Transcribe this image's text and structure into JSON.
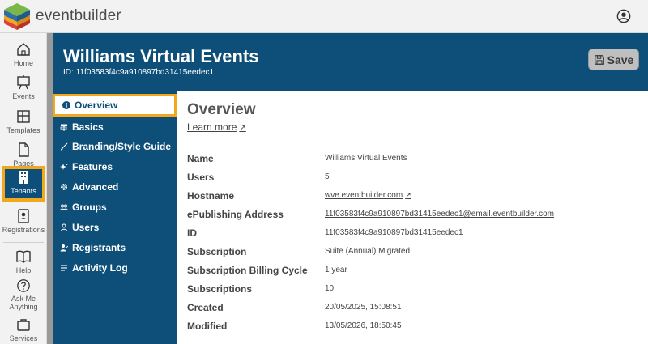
{
  "app": {
    "brand": "eventbuilder"
  },
  "colors": {
    "primary": "#0d4f78",
    "highlight": "#f2a81d"
  },
  "rail": {
    "items": [
      {
        "label": "Home",
        "icon": "home-icon"
      },
      {
        "label": "Events",
        "icon": "easel-icon"
      },
      {
        "label": "Templates",
        "icon": "layout-icon"
      },
      {
        "label": "Pages",
        "icon": "page-icon"
      },
      {
        "label": "Tenants",
        "icon": "building-icon",
        "active": true
      },
      {
        "label": "Registrations",
        "icon": "id-badge-icon"
      },
      {
        "label": "Help",
        "icon": "book-icon"
      },
      {
        "label_line1": "Ask Me",
        "label_line2": "Anything",
        "icon": "question-icon"
      },
      {
        "label": "Services",
        "icon": "briefcase-icon"
      }
    ]
  },
  "header": {
    "title": "Williams Virtual Events",
    "id_line": "ID: 11f03583f4c9a910897bd31415eedec1",
    "save_label": "Save"
  },
  "nav": {
    "items": [
      {
        "label": "Overview",
        "icon": "info-icon",
        "active": true
      },
      {
        "label": "Basics",
        "icon": "signpost-icon"
      },
      {
        "label": "Branding/Style Guide",
        "icon": "brush-icon"
      },
      {
        "label": "Features",
        "icon": "sparkle-icon"
      },
      {
        "label": "Advanced",
        "icon": "gear-icon"
      },
      {
        "label": "Groups",
        "icon": "group-icon"
      },
      {
        "label": "Users",
        "icon": "user-icon"
      },
      {
        "label": "Registrants",
        "icon": "registrant-icon"
      },
      {
        "label": "Activity Log",
        "icon": "list-icon"
      }
    ]
  },
  "overview": {
    "title": "Overview",
    "learn_more": "Learn more",
    "rows": [
      {
        "label": "Name",
        "value": "Williams Virtual Events"
      },
      {
        "label": "Users",
        "value": "5"
      },
      {
        "label": "Hostname",
        "value": "wve.eventbuilder.com"
      },
      {
        "label": "ePublishing Address",
        "value": "11f03583f4c9a910897bd31415eedec1@email.eventbuilder.com"
      },
      {
        "label": "ID",
        "value": "11f03583f4c9a910897bd31415eedec1"
      },
      {
        "label": "Subscription",
        "value": "Suite (Annual) Migrated"
      },
      {
        "label": "Subscription Billing Cycle",
        "value": "1 year"
      },
      {
        "label": "Subscriptions",
        "value": "10"
      },
      {
        "label": "Created",
        "value": "20/05/2025, 15:08:51"
      },
      {
        "label": "Modified",
        "value": "13/05/2026, 18:50:45"
      }
    ]
  }
}
